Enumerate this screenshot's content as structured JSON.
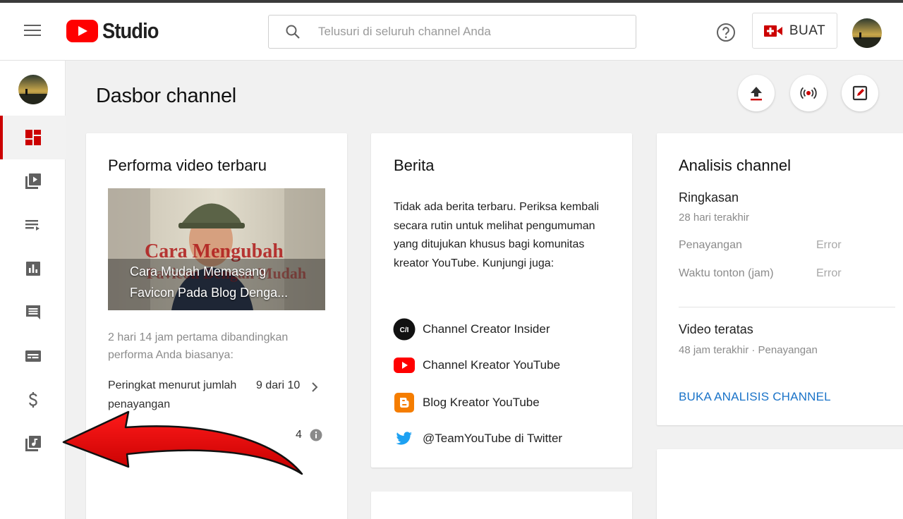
{
  "header": {
    "logo_text": "Studio",
    "search_placeholder": "Telusuri di seluruh channel Anda",
    "create_label": "BUAT"
  },
  "page": {
    "title": "Dasbor channel"
  },
  "performance_card": {
    "title": "Performa video terbaru",
    "video_title": "Cara Mudah Memasang Favicon Pada Blog Denga...",
    "thumb_overlay": "Cara Mengubah Favicon Dengan Mudah",
    "comparison_text": "2 hari 14 jam pertama dibandingkan performa Anda biasanya:",
    "rank_label": "Peringkat menurut jumlah penayangan",
    "rank_value": "9 dari 10",
    "metric_value": "4"
  },
  "news_card": {
    "title": "Berita",
    "body": "Tidak ada berita terbaru. Periksa kembali secara rutin untuk melihat pengumuman yang ditujukan khusus bagi komunitas kreator YouTube. Kunjungi juga:",
    "links": [
      {
        "label": "Channel Creator Insider",
        "icon": "creator-insider-icon"
      },
      {
        "label": "Channel Kreator YouTube",
        "icon": "youtube-icon"
      },
      {
        "label": "Blog Kreator YouTube",
        "icon": "blogger-icon"
      },
      {
        "label": "@TeamYouTube di Twitter",
        "icon": "twitter-icon"
      }
    ],
    "ci_glyph": "C/I"
  },
  "analytics_card": {
    "title": "Analisis channel",
    "summary_title": "Ringkasan",
    "summary_period": "28 hari terakhir",
    "rows": [
      {
        "label": "Penayangan",
        "value": "Error"
      },
      {
        "label": "Waktu tonton (jam)",
        "value": "Error"
      }
    ],
    "top_videos_title": "Video teratas",
    "top_videos_sub": "48 jam terakhir · Penayangan",
    "open_label": "BUKA ANALISIS CHANNEL"
  },
  "colors": {
    "accent_red": "#ff0000",
    "link_blue": "#1a73c8",
    "arrow_red": "#e60000"
  }
}
